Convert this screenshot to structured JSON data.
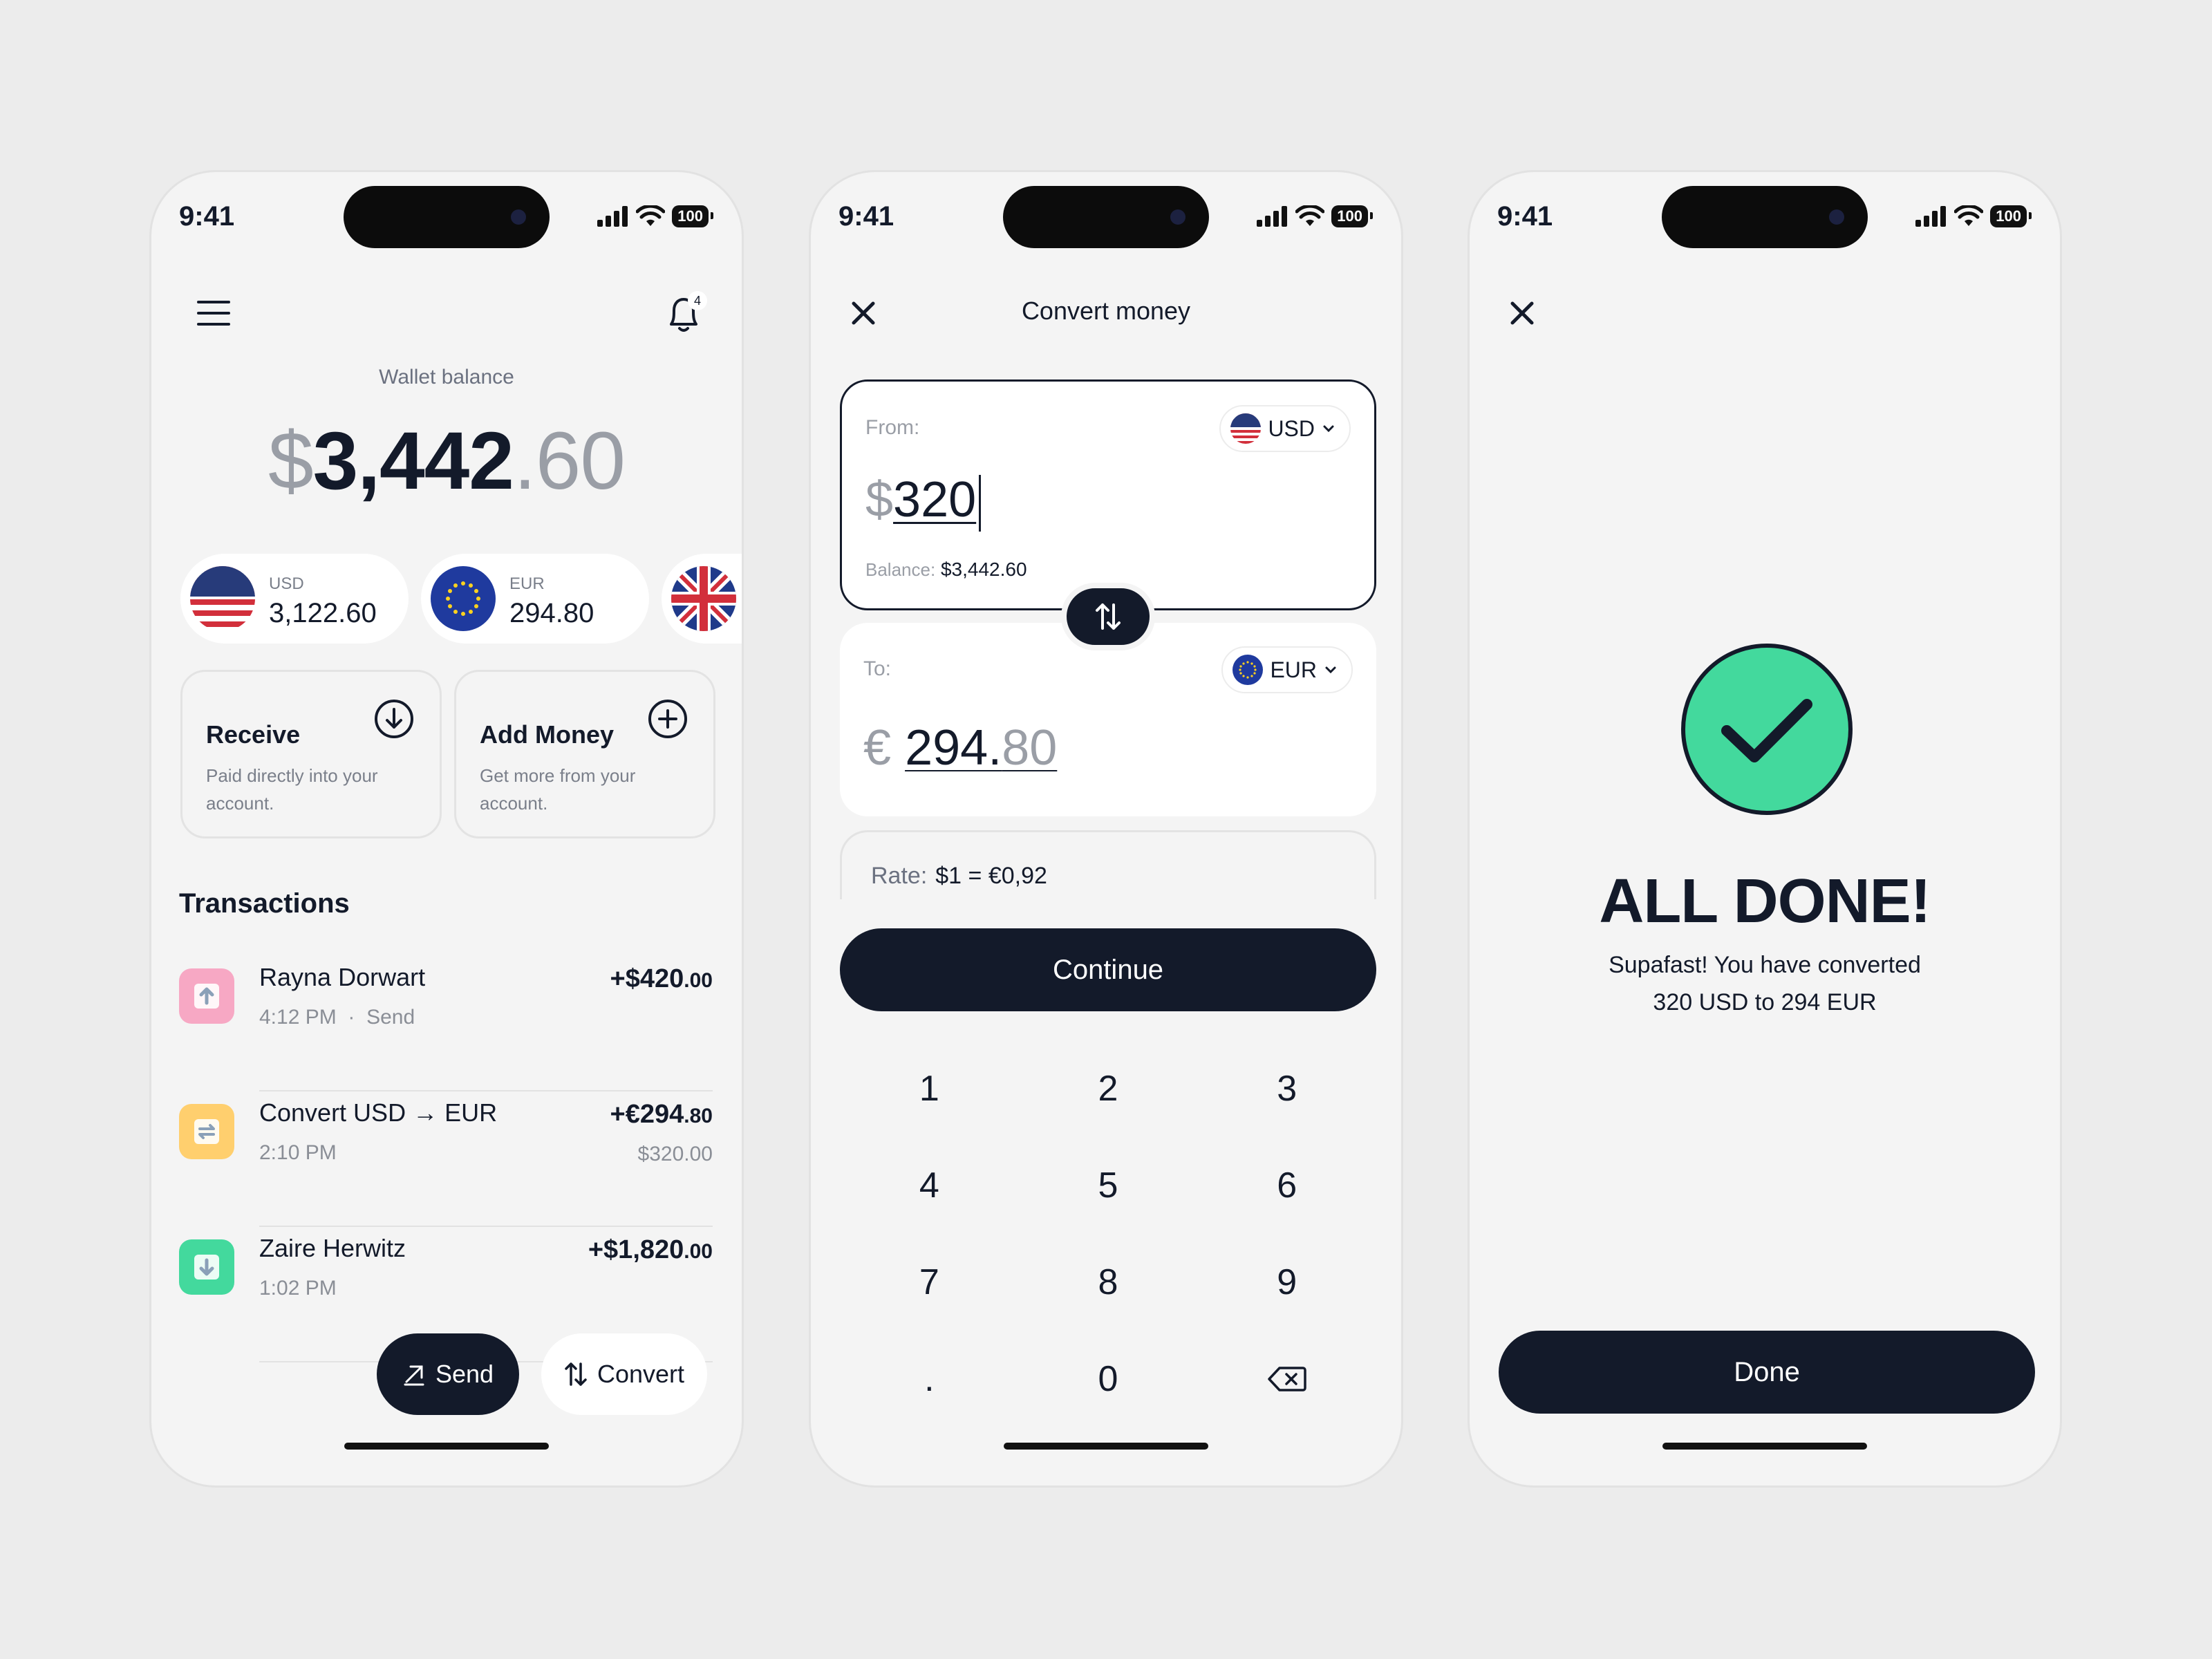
{
  "status_bar": {
    "time": "9:41",
    "battery": "100"
  },
  "home": {
    "notification_count": "4",
    "wallet_label": "Wallet balance",
    "balance": {
      "symbol": "$",
      "whole": "3,442",
      "decimal": ".60"
    },
    "currencies": [
      {
        "code": "USD",
        "amount": "3,122.60"
      },
      {
        "code": "EUR",
        "amount": "294.80"
      }
    ],
    "actions": [
      {
        "title": "Receive",
        "desc": "Paid directly into your account."
      },
      {
        "title": "Add Money",
        "desc": "Get more from your account."
      }
    ],
    "transactions_title": "Transactions",
    "transactions": [
      {
        "name": "Rayna Dorwart",
        "time": "4:12 PM",
        "type": "Send",
        "amount": "+$420",
        "cents": ".00",
        "color": "#f7a8c4"
      },
      {
        "name": "Convert USD → EUR",
        "time": "2:10 PM",
        "amount": "+€294",
        "cents": ".80",
        "sub": "$320.00",
        "color": "#ffcf6e"
      },
      {
        "name": "Zaire Herwitz",
        "time": "1:02 PM",
        "amount": "+$1,820",
        "cents": ".00",
        "color": "#43d99d"
      }
    ],
    "send_label": "Send",
    "convert_label": "Convert"
  },
  "convert": {
    "title": "Convert money",
    "from": {
      "label": "From:",
      "currency": "USD",
      "symbol": "$",
      "amount": "320",
      "balance_label": "Balance:",
      "balance": "$3,442.60"
    },
    "to": {
      "label": "To:",
      "currency": "EUR",
      "symbol": "€",
      "amount_whole": "294.",
      "amount_decimal": "80"
    },
    "rate_label": "Rate:",
    "rate": "$1 = €0,92",
    "continue_label": "Continue",
    "keys": [
      "1",
      "2",
      "3",
      "4",
      "5",
      "6",
      "7",
      "8",
      "9",
      ".",
      "0"
    ]
  },
  "done": {
    "title": "ALL DONE!",
    "line1": "Supafast! You have converted",
    "line2": "320 USD to 294 EUR",
    "button": "Done"
  },
  "colors": {
    "primary": "#131a2a",
    "success": "#43d99d",
    "background": "#f4f4f4"
  }
}
